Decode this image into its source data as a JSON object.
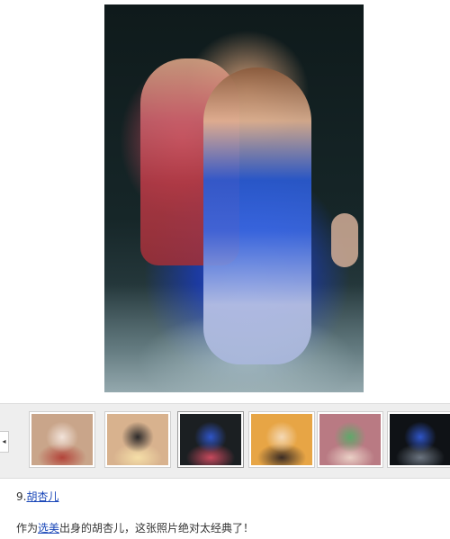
{
  "main_photo": {
    "subject": "performer-embrace-stage-photo"
  },
  "thumbnails": [
    {
      "id": "thumb-1",
      "icon": "photo-woman-closeup",
      "colors": [
        "#c9a58a",
        "#f2e3da",
        "#b3443a"
      ]
    },
    {
      "id": "thumb-2",
      "icon": "photo-man-smiling",
      "colors": [
        "#d8b28e",
        "#2c2a2a",
        "#f5dfa8"
      ]
    },
    {
      "id": "thumb-3",
      "icon": "photo-dance-couple",
      "colors": [
        "#1b1f22",
        "#2f55c8",
        "#c7495d"
      ]
    },
    {
      "id": "thumb-4",
      "icon": "photo-woman-singing",
      "colors": [
        "#e7a545",
        "#f4d9b6",
        "#3b2c24"
      ]
    },
    {
      "id": "thumb-5",
      "icon": "photo-group-stage",
      "colors": [
        "#b97a83",
        "#5fa86a",
        "#ead0c6"
      ]
    },
    {
      "id": "thumb-6",
      "icon": "photo-performer-blue",
      "colors": [
        "#0f1216",
        "#2f55c8",
        "#6b7480"
      ]
    }
  ],
  "caption": {
    "index": "9.",
    "name_link": "胡杏儿"
  },
  "description": {
    "prefix": "作为",
    "link": "选美",
    "suffix": "出身的胡杏儿，这张照片绝对太经典了！"
  },
  "strip": {
    "prev_arrow": "◂"
  }
}
